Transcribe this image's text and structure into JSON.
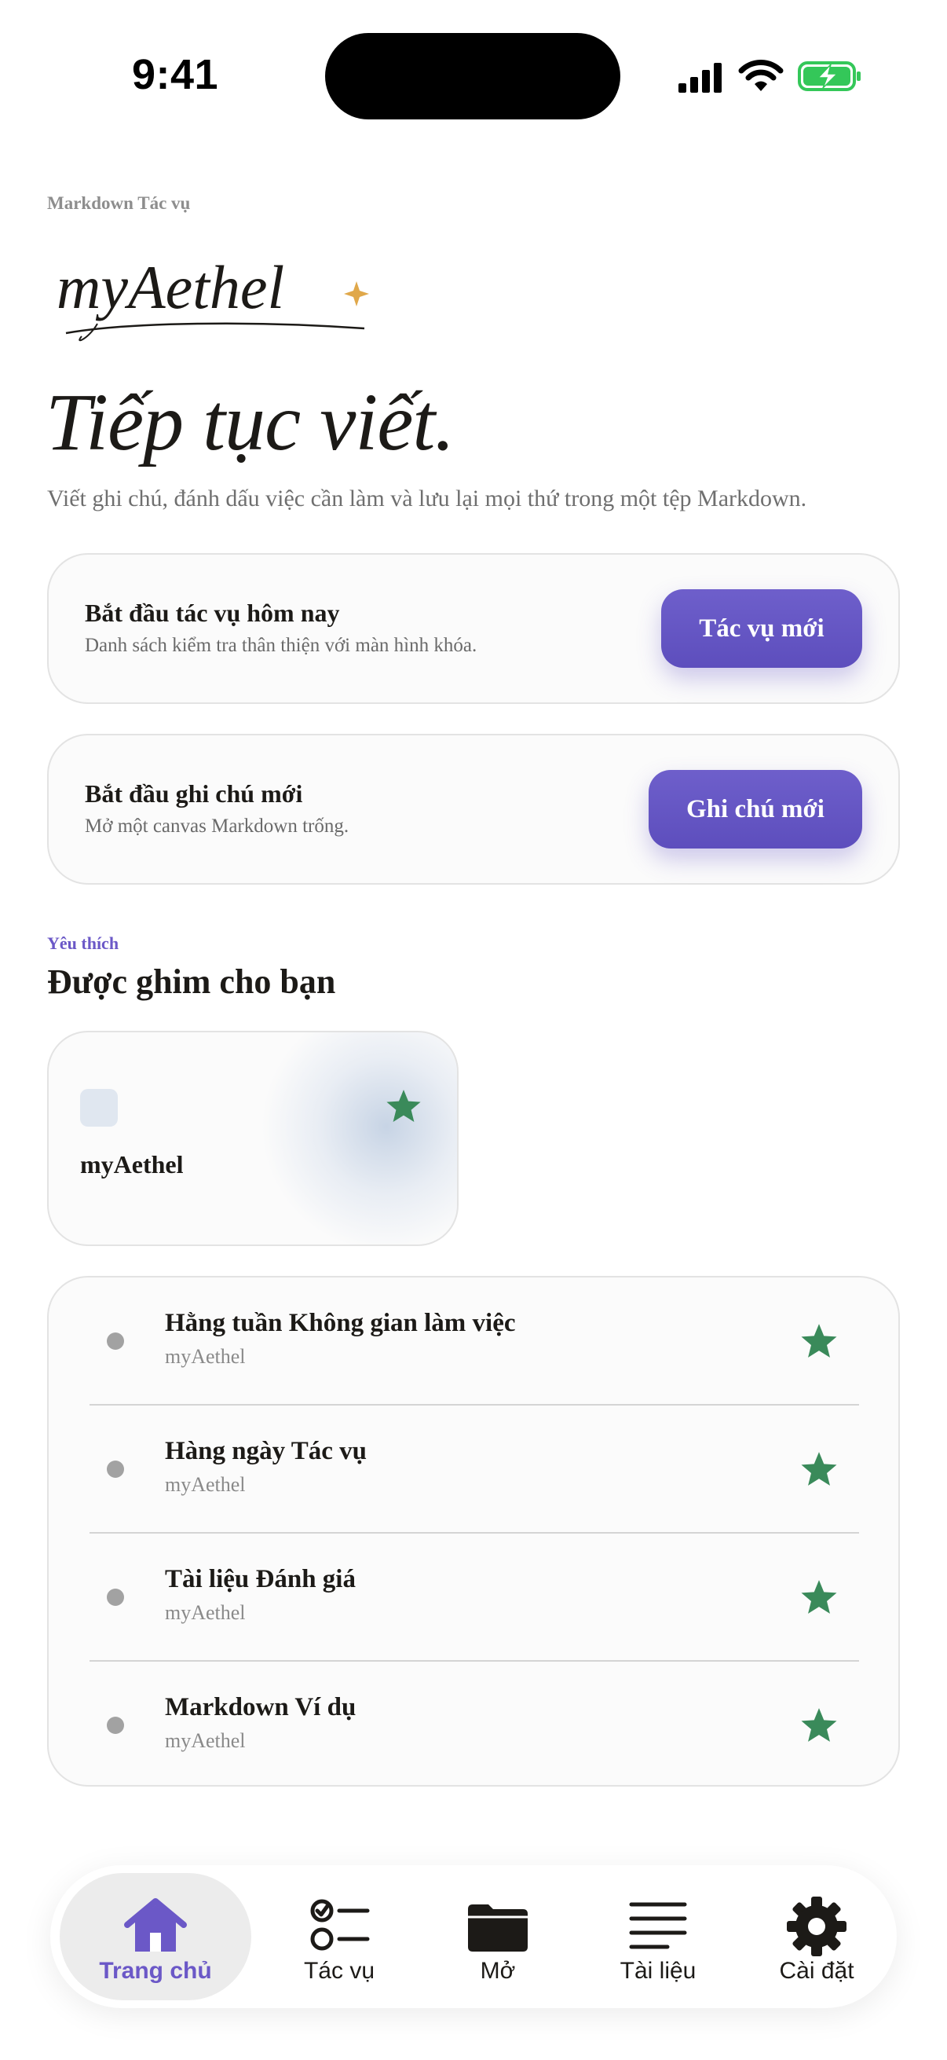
{
  "status_bar": {
    "time": "9:41",
    "battery_color": "#34c759"
  },
  "header": {
    "eyebrow": "Markdown Tác vụ",
    "logo_text": "myAethel",
    "logo_sparkle_color": "#e0a84a",
    "headline": "Tiếp tục viết.",
    "subtitle": "Viết ghi chú, đánh dấu việc cần làm và lưu lại mọi thứ trong một tệp Markdown."
  },
  "actions": [
    {
      "title": "Bắt đầu tác vụ hôm nay",
      "subtitle": "Danh sách kiểm tra thân thiện với màn hình khóa.",
      "button": "Tác vụ mới"
    },
    {
      "title": "Bắt đầu ghi chú mới",
      "subtitle": "Mở một canvas Markdown trống.",
      "button": "Ghi chú mới"
    }
  ],
  "favorites": {
    "eyebrow": "Yêu thích",
    "title": "Được ghim cho bạn",
    "pinned": {
      "label": "myAethel",
      "icon": "star-icon"
    },
    "items": [
      {
        "title": "Hằng tuần Không gian làm việc",
        "subtitle": "myAethel"
      },
      {
        "title": "Hàng ngày Tác vụ",
        "subtitle": "myAethel"
      },
      {
        "title": "Tài liệu Đánh giá",
        "subtitle": "myAethel"
      },
      {
        "title": "Markdown Ví dụ",
        "subtitle": "myAethel"
      }
    ],
    "star_color": "#3a8a5a"
  },
  "tabbar": {
    "tabs": [
      {
        "label": "Trang chủ",
        "icon": "home-icon",
        "active": true
      },
      {
        "label": "Tác vụ",
        "icon": "checklist-icon",
        "active": false
      },
      {
        "label": "Mở",
        "icon": "folder-icon",
        "active": false
      },
      {
        "label": "Tài liệu",
        "icon": "document-lines-icon",
        "active": false
      },
      {
        "label": "Cài đặt",
        "icon": "gear-icon",
        "active": false
      }
    ],
    "accent": "#6b58c7"
  }
}
